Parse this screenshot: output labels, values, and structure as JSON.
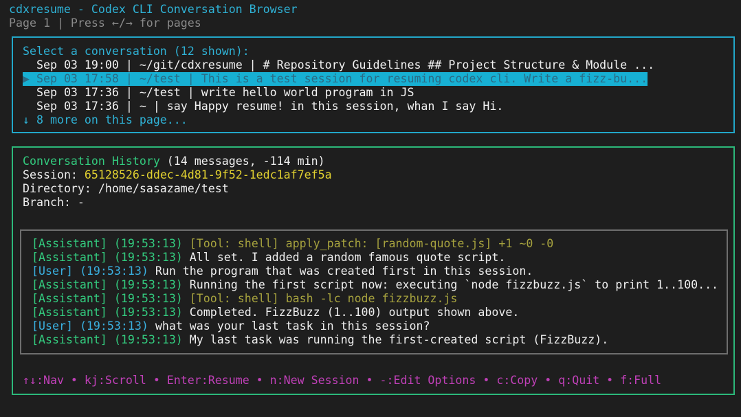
{
  "app": {
    "title": "cdxresume - Codex CLI Conversation Browser",
    "page_hint": "Page 1 | Press ←/→ for pages"
  },
  "conversation_list": {
    "heading": "Select a conversation (12 shown):",
    "rows": [
      {
        "text": "  Sep 03 19:00 | ~/git/cdxresume | # Repository Guidelines ## Project Structure & Module ...",
        "selected": false
      },
      {
        "text": "▶ Sep 03 17:58 | ~/test | This is a test session for resuming codex cli. Write a fizz-bu...",
        "selected": true
      },
      {
        "text": "  Sep 03 17:36 | ~/test | write hello world program in JS",
        "selected": false
      },
      {
        "text": "  Sep 03 17:36 | ~ | say Happy resume! in this session, whan I say Hi.",
        "selected": false
      }
    ],
    "more_text": "↓ 8 more on this page..."
  },
  "history": {
    "heading": "Conversation History",
    "meta": " (14 messages, -114 min)",
    "session_label": "Session: ",
    "session_id": "65128526-ddec-4d81-9f52-1edc1af7ef5a",
    "directory": "Directory: /home/sasazame/test",
    "branch": "Branch: -",
    "messages": [
      {
        "role": "[Assistant]",
        "time": " (19:53:13) ",
        "text": "[Tool: shell] apply_patch: [random-quote.js] +1 ~0 -0",
        "kind": "tool"
      },
      {
        "role": "[Assistant]",
        "time": " (19:53:13) ",
        "text": "All set. I added a random famous quote script.",
        "kind": "assistant"
      },
      {
        "role": "[User]",
        "time": " (19:53:13) ",
        "text": "Run the program that was created first in this session.",
        "kind": "user"
      },
      {
        "role": "[Assistant]",
        "time": " (19:53:13) ",
        "text": "Running the first script now: executing `node fizzbuzz.js` to print 1..100...",
        "kind": "assistant"
      },
      {
        "role": "[Assistant]",
        "time": " (19:53:13) ",
        "text": "[Tool: shell] bash -lc node fizzbuzz.js",
        "kind": "tool"
      },
      {
        "role": "[Assistant]",
        "time": " (19:53:13) ",
        "text": "Completed. FizzBuzz (1..100) output shown above.",
        "kind": "assistant"
      },
      {
        "role": "[User]",
        "time": " (19:53:13) ",
        "text": "what was your last task in this session?",
        "kind": "user"
      },
      {
        "role": "[Assistant]",
        "time": " (19:53:13) ",
        "text": "My last task was running the first-created script (FizzBuzz).",
        "kind": "assistant"
      }
    ]
  },
  "footer": {
    "shortcuts": "↑↓:Nav • kj:Scroll • Enter:Resume • n:New Session • -:Edit Options • c:Copy • q:Quit • f:Full"
  },
  "colors": {
    "background": "#1e1e1e",
    "cyan_accent": "#2fb2d6",
    "green_accent": "#2cb87a",
    "session_yellow": "#e0d030",
    "footer_magenta": "#c040b8"
  }
}
